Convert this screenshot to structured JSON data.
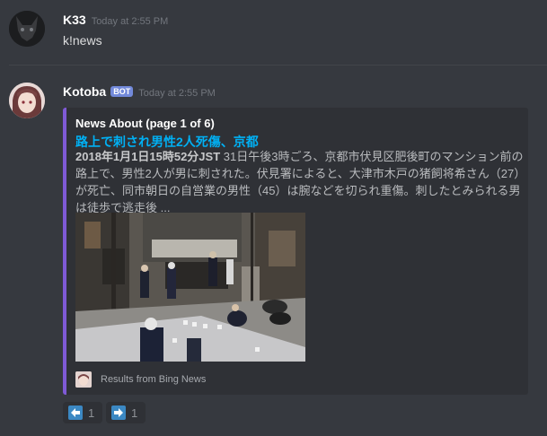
{
  "messages": [
    {
      "author": "K33",
      "timestamp": "Today at 2:55 PM",
      "content": "k!news"
    },
    {
      "author": "Kotoba",
      "bot_tag": "BOT",
      "timestamp": "Today at 2:55 PM",
      "embed": {
        "accent_color": "#7f5ad6",
        "author": "News About (page 1 of 6)",
        "title": "路上で刺され男性2人死傷、京都",
        "date_bold": "2018年1月1日15時52分JST",
        "description": " 31日午後3時ごろ、京都市伏見区肥後町のマンション前の路上で、男性2人が男に刺された。伏見署によると、大津市木戸の猪飼将希さん（27）が死亡、同市朝日の自営業の男性（45）は腕などを切られ重傷。刺したとみられる男は徒歩で逃走後 ...",
        "footer": "Results from Bing News"
      },
      "reactions": [
        {
          "icon": "arrow-left-icon",
          "count": "1"
        },
        {
          "icon": "arrow-right-icon",
          "count": "1"
        }
      ]
    }
  ],
  "colors": {
    "background": "#36393f",
    "embed_bg": "#2f3136",
    "link": "#00b0f4",
    "bot_badge": "#7289da",
    "reaction_icon": "#3b88c3"
  }
}
